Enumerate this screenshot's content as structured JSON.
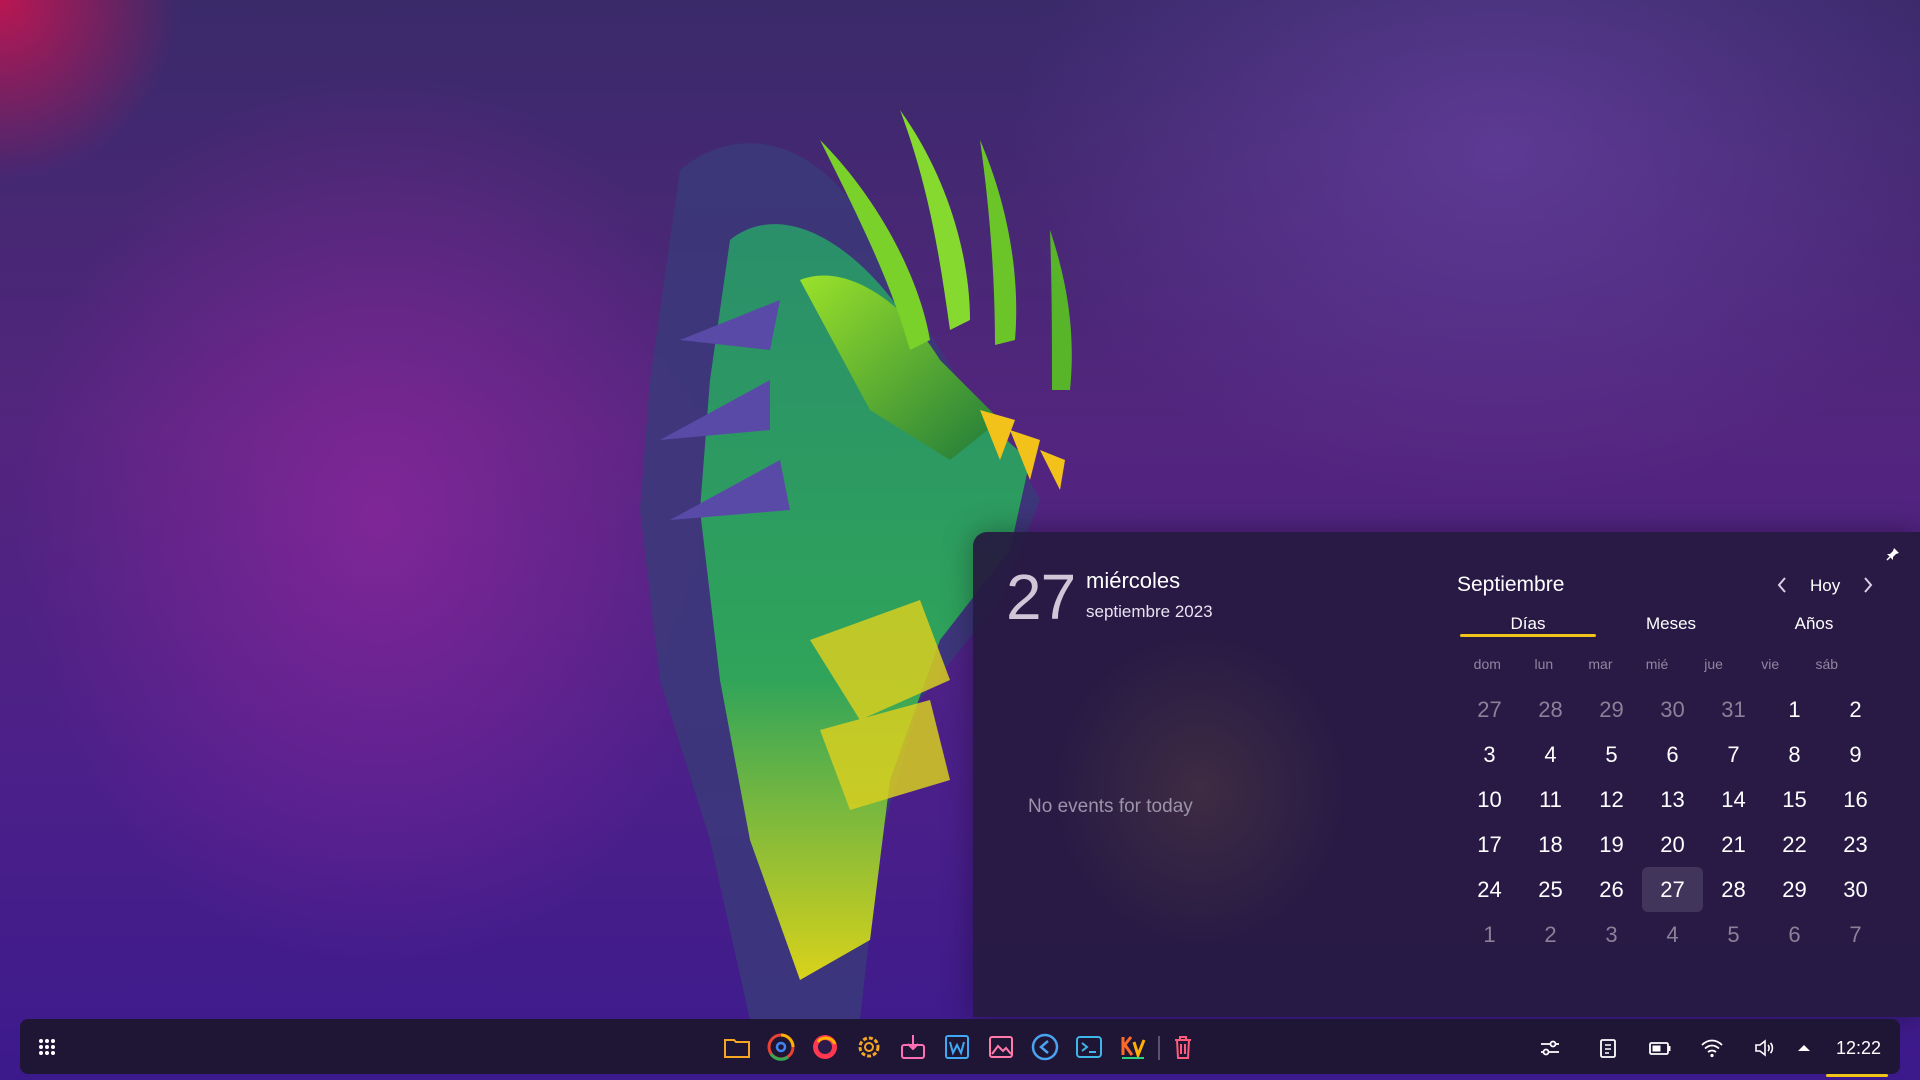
{
  "calendar": {
    "day_number": "27",
    "weekday": "miércoles",
    "month_year": "septiembre 2023",
    "no_events": "No events for today",
    "month_title": "Septiembre",
    "today_label": "Hoy",
    "tabs": [
      "Días",
      "Meses",
      "Años"
    ],
    "weekdays": [
      "dom",
      "lun",
      "mar",
      "mié",
      "jue",
      "vie",
      "sáb"
    ],
    "days": [
      {
        "label": "27",
        "muted": true
      },
      {
        "label": "28",
        "muted": true
      },
      {
        "label": "29",
        "muted": true
      },
      {
        "label": "30",
        "muted": true
      },
      {
        "label": "31",
        "muted": true
      },
      {
        "label": "1"
      },
      {
        "label": "2"
      },
      {
        "label": "3"
      },
      {
        "label": "4"
      },
      {
        "label": "5"
      },
      {
        "label": "6"
      },
      {
        "label": "7"
      },
      {
        "label": "8"
      },
      {
        "label": "9"
      },
      {
        "label": "10"
      },
      {
        "label": "11"
      },
      {
        "label": "12"
      },
      {
        "label": "13"
      },
      {
        "label": "14"
      },
      {
        "label": "15"
      },
      {
        "label": "16"
      },
      {
        "label": "17"
      },
      {
        "label": "18"
      },
      {
        "label": "19"
      },
      {
        "label": "20"
      },
      {
        "label": "21"
      },
      {
        "label": "22"
      },
      {
        "label": "23"
      },
      {
        "label": "24"
      },
      {
        "label": "25"
      },
      {
        "label": "26"
      },
      {
        "label": "27",
        "today": true
      },
      {
        "label": "28"
      },
      {
        "label": "29"
      },
      {
        "label": "30"
      },
      {
        "label": "1",
        "muted": true
      },
      {
        "label": "2",
        "muted": true
      },
      {
        "label": "3",
        "muted": true
      },
      {
        "label": "4",
        "muted": true
      },
      {
        "label": "5",
        "muted": true
      },
      {
        "label": "6",
        "muted": true
      },
      {
        "label": "7",
        "muted": true
      }
    ]
  },
  "taskbar": {
    "launcher_icon": "app-grid-icon",
    "apps": [
      "files-folder-icon",
      "chrome-icon",
      "firefox-icon",
      "settings-gear-icon",
      "software-installer-icon",
      "writer-icon",
      "image-viewer-icon",
      "vscode-icon",
      "terminal-icon",
      "kv-editor-icon",
      "trash-icon"
    ],
    "tray": [
      "sliders-icon",
      "clipboard-icon",
      "battery-icon",
      "wifi-icon",
      "volume-icon",
      "chevron-up-icon"
    ],
    "clock": "12:22"
  },
  "colors": {
    "accent": "#f0c419",
    "popup_bg": "#261a40",
    "muted_text": "#8a8198"
  }
}
